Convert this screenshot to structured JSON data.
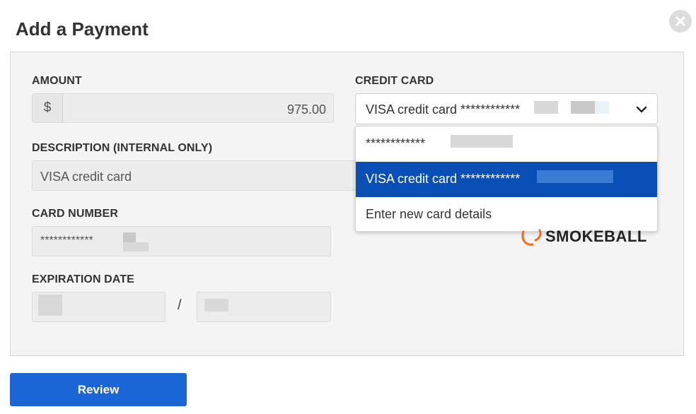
{
  "dialog": {
    "title": "Add a Payment",
    "close_icon": "close-circle-icon"
  },
  "form": {
    "amount": {
      "label": "AMOUNT",
      "currency_symbol": "$",
      "value": "975.00"
    },
    "description": {
      "label": "DESCRIPTION (INTERNAL ONLY)",
      "value": "VISA credit card"
    },
    "card_number": {
      "label": "CARD NUMBER",
      "masked_prefix": "************"
    },
    "expiration": {
      "label": "EXPIRATION DATE",
      "separator": "/"
    },
    "credit_card": {
      "label": "CREDIT CARD",
      "selected_value": "VISA credit card ************",
      "chevron_icon": "chevron-down-icon",
      "options": [
        {
          "label": "************",
          "selected": false
        },
        {
          "label": "VISA credit card ************",
          "selected": true
        },
        {
          "label": "Enter new card details",
          "selected": false
        }
      ]
    }
  },
  "brand": {
    "name": "SMOKEBALL",
    "logo_color": "#f26a21"
  },
  "actions": {
    "review_label": "Review"
  },
  "colors": {
    "primary_button": "#1a66d6",
    "selected_option": "#0a4fb5"
  }
}
